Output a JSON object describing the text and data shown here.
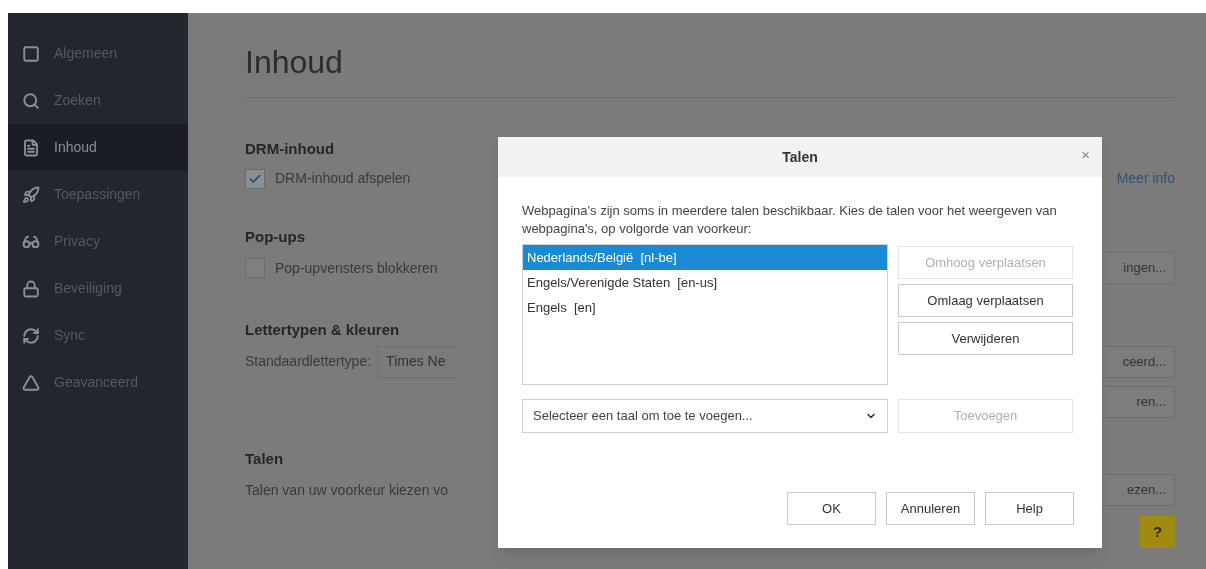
{
  "sidebar": {
    "items": [
      {
        "label": "Algemeen",
        "selected": false
      },
      {
        "label": "Zoeken",
        "selected": false
      },
      {
        "label": "Inhoud",
        "selected": true
      },
      {
        "label": "Toepassingen",
        "selected": false
      },
      {
        "label": "Privacy",
        "selected": false
      },
      {
        "label": "Beveiliging",
        "selected": false
      },
      {
        "label": "Sync",
        "selected": false
      },
      {
        "label": "Geavanceerd",
        "selected": false
      }
    ]
  },
  "page": {
    "title": "Inhoud",
    "drm": {
      "heading": "DRM-inhoud",
      "checkbox": {
        "label": "DRM-inhoud afspelen",
        "checked": true
      },
      "link": "Meer info"
    },
    "popups": {
      "heading": "Pop-ups",
      "checkbox": {
        "label": "Pop-upvensters blokkeren",
        "checked": false
      },
      "button": "ingen..."
    },
    "fonts": {
      "heading": "Lettertypen & kleuren",
      "label": "Standaardlettertype:",
      "select": "Times Ne",
      "buttons": [
        "ceerd...",
        "ren..."
      ]
    },
    "languages": {
      "heading": "Talen",
      "text": "Talen van uw voorkeur kiezen vo",
      "button": "ezen..."
    },
    "help": "?"
  },
  "dialog": {
    "title": "Talen",
    "close": "×",
    "description": "Webpagina's zijn soms in meerdere talen beschikbaar. Kies de talen voor het weergeven van webpagina's, op volgorde van voorkeur:",
    "languages": [
      {
        "label": "Nederlands/België  [nl-be]",
        "selected": true
      },
      {
        "label": "Engels/Verenigde Staten  [en-us]",
        "selected": false
      },
      {
        "label": "Engels  [en]",
        "selected": false
      }
    ],
    "side_buttons": [
      {
        "label": "Omhoog verplaatsen",
        "disabled": true
      },
      {
        "label": "Omlaag verplaatsen",
        "disabled": false
      },
      {
        "label": "Verwijderen",
        "disabled": false
      }
    ],
    "select": {
      "placeholder": "Selecteer een taal om toe te voegen..."
    },
    "add_button": {
      "label": "Toevoegen",
      "disabled": true
    },
    "buttons": [
      "OK",
      "Annuleren",
      "Help"
    ]
  }
}
